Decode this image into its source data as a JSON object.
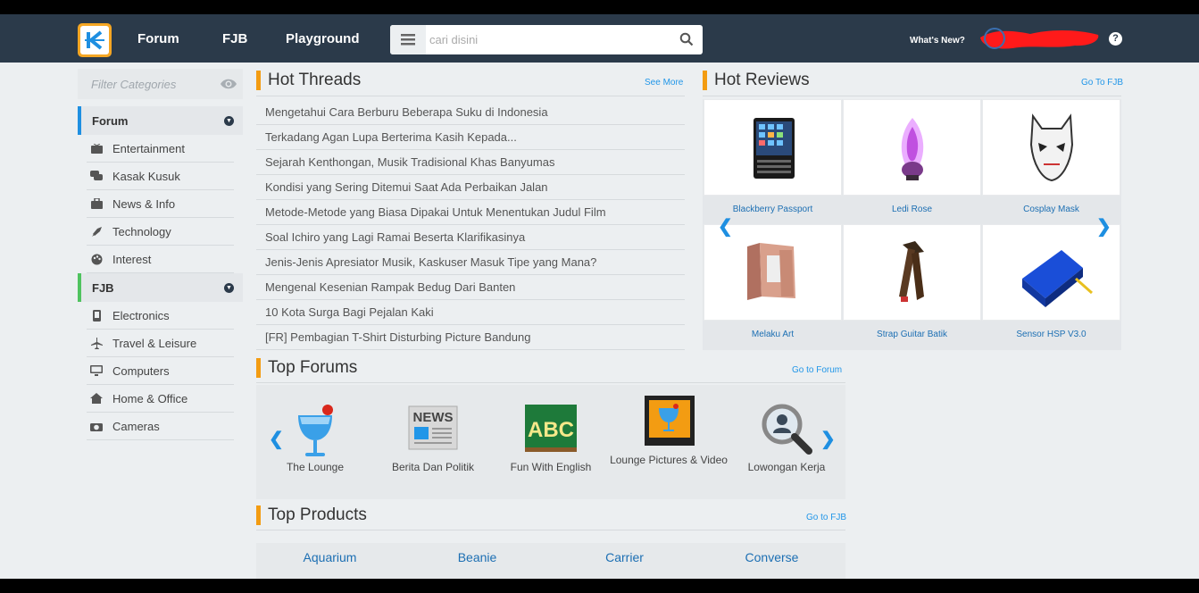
{
  "header": {
    "nav": [
      "Forum",
      "FJB",
      "Playground"
    ],
    "search_placeholder": "cari disini",
    "whats_new": "What's New?",
    "help": "?"
  },
  "sidebar": {
    "filter_placeholder": "Filter Categories",
    "forum_label": "Forum",
    "forum_items": [
      "Entertainment",
      "Kasak Kusuk",
      "News & Info",
      "Technology",
      "Interest"
    ],
    "fjb_label": "FJB",
    "fjb_items": [
      "Electronics",
      "Travel & Leisure",
      "Computers",
      "Home & Office",
      "Cameras"
    ]
  },
  "hot_threads": {
    "title": "Hot Threads",
    "link": "See More",
    "items": [
      "Mengetahui Cara Berburu Beberapa Suku di Indonesia",
      "Terkadang Agan Lupa Berterima Kasih Kepada...",
      "Sejarah Kenthongan, Musik Tradisional Khas Banyumas",
      "Kondisi yang Sering Ditemui Saat Ada Perbaikan Jalan",
      "Metode-Metode yang Biasa Dipakai Untuk Menentukan Judul Film",
      "Soal Ichiro yang Lagi Ramai Beserta Klarifikasinya",
      "Jenis-Jenis Apresiator Musik, Kaskuser Masuk Tipe yang Mana?",
      "Mengenal Kesenian Rampak Bedug Dari Banten",
      "10 Kota Surga Bagi Pejalan Kaki",
      "[FR] Pembagian T-Shirt Disturbing Picture Bandung"
    ]
  },
  "hot_reviews": {
    "title": "Hot Reviews",
    "link": "Go To FJB",
    "items": [
      "Blackberry Passport",
      "Ledi Rose",
      "Cosplay Mask",
      "Melaku Art",
      "Strap Guitar Batik",
      "Sensor HSP V3.0"
    ]
  },
  "top_forums": {
    "title": "Top Forums",
    "link": "Go to Forum",
    "items": [
      "The Lounge",
      "Berita Dan Politik",
      "Fun With English",
      "Lounge Pictures & Video",
      "Lowongan Kerja"
    ],
    "news_badge": "NEWS",
    "abc_badge": "ABC"
  },
  "top_products": {
    "title": "Top Products",
    "link": "Go to FJB",
    "items": [
      "Aquarium",
      "Beanie",
      "Carrier",
      "Converse"
    ]
  },
  "colors": {
    "header": "#2b3a4a",
    "accent": "#f39c12",
    "link": "#2196e8",
    "forum": "#1e8fe1",
    "fjb": "#4fc35f"
  }
}
